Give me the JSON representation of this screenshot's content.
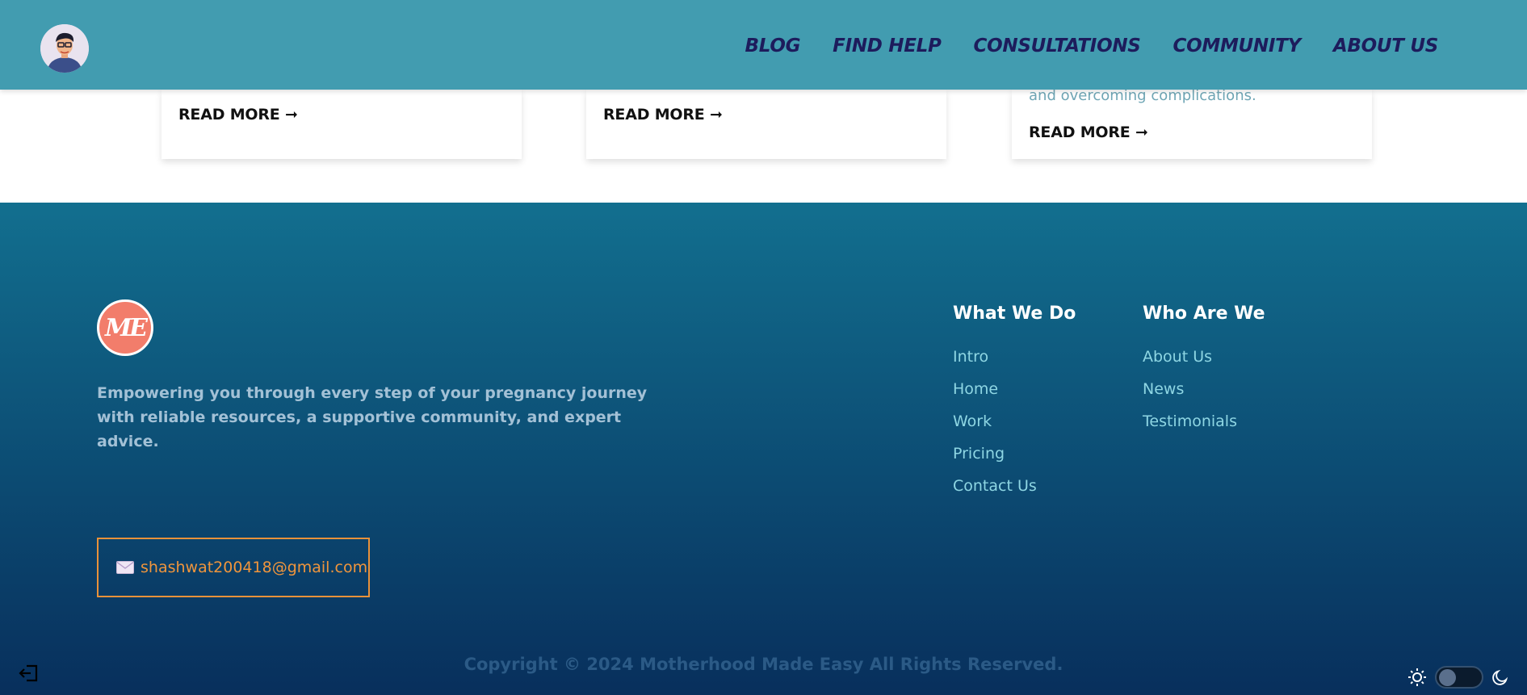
{
  "header": {
    "nav": [
      "BLOG",
      "FIND HELP",
      "CONSULTATIONS",
      "COMMUNITY",
      "ABOUT US"
    ]
  },
  "cards": [
    {
      "read_more": "READ MORE ➞"
    },
    {
      "read_more": "READ MORE ➞"
    },
    {
      "excerpt": "and overcoming complications.",
      "read_more": "READ MORE ➞"
    }
  ],
  "footer": {
    "logo_text": "ME",
    "tagline": "Empowering you through every step of your pregnancy journey with reliable resources, a supportive community, and expert advice.",
    "what_we_do": {
      "title": "What We Do",
      "links": [
        "Intro",
        "Home",
        "Work",
        "Pricing",
        "Contact Us"
      ]
    },
    "who_are_we": {
      "title": "Who Are We",
      "links": [
        "About Us",
        "News",
        "Testimonials"
      ]
    },
    "email": "shashwat200418@gmail.com",
    "copyright": "Copyright © 2024 Motherhood Made Easy All Rights Reserved.",
    "theme": "light"
  },
  "colors": {
    "header_bg": "#429cb0",
    "nav_text": "#1d1c5c",
    "footer_link": "#8ed6e3",
    "email_accent": "#f0953c",
    "logo_bg": "#f27d6b"
  }
}
